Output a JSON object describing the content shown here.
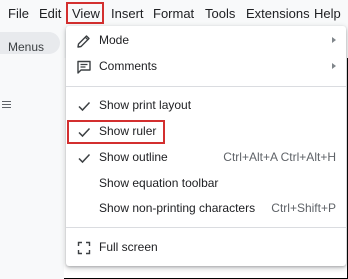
{
  "menubar": {
    "items": [
      "File",
      "Edit",
      "View",
      "Insert",
      "Format",
      "Tools",
      "Extensions",
      "Help"
    ]
  },
  "toolbar": {
    "menus_label": "Menus"
  },
  "view_menu": {
    "mode": "Mode",
    "comments": "Comments",
    "show_print_layout": "Show print layout",
    "show_ruler": "Show ruler",
    "show_outline": "Show outline",
    "show_outline_shortcut": "Ctrl+Alt+A Ctrl+Alt+H",
    "show_equation_toolbar": "Show equation toolbar",
    "show_non_printing": "Show non-printing characters",
    "show_non_printing_shortcut": "Ctrl+Shift+P",
    "full_screen": "Full screen"
  },
  "colors": {
    "highlight": "#d32f2f",
    "menubar_bg": "#f8f9fa"
  },
  "icons": [
    "pencil-icon",
    "comment-icon",
    "check-icon",
    "fullscreen-icon",
    "submenu-arrow-icon"
  ]
}
